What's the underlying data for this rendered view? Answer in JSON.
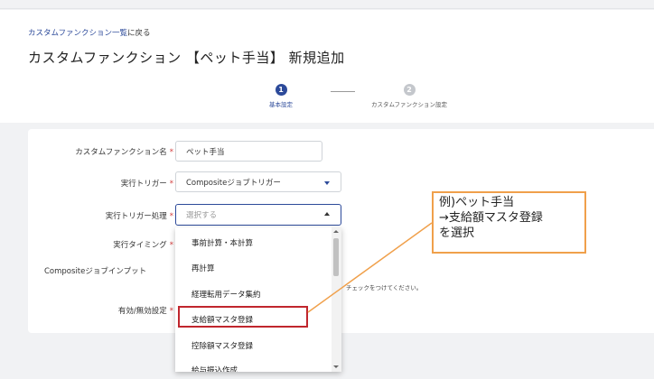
{
  "breadcrumb": {
    "link": "カスタムファンクション一覧",
    "suffix": "に戻る"
  },
  "page_title": "カスタムファンクション 【ペット手当】 新規追加",
  "steps": [
    {
      "number": "1",
      "label": "基本設定",
      "active": true
    },
    {
      "number": "2",
      "label": "カスタムファンクション設定",
      "active": false
    }
  ],
  "form": {
    "name_label": "カスタムファンクション名",
    "name_value": "ペット手当",
    "trigger_label": "実行トリガー",
    "trigger_value": "Compositeジョブトリガー",
    "trigger_process_label": "実行トリガー処理",
    "trigger_process_placeholder": "選択する",
    "timing_label": "実行タイミング",
    "job_input_label": "Compositeジョブインプット",
    "job_input_hint": "チェックをつけてください。",
    "enabled_label": "有効/無効設定",
    "required_mark": "*"
  },
  "dropdown": {
    "options": [
      "事前計算・本計算",
      "再計算",
      "経理転用データ集約",
      "支給額マスタ登録",
      "控除額マスタ登録",
      "給与振込作成"
    ],
    "highlighted": "支給額マスタ登録"
  },
  "callout": {
    "lines": [
      "例)ペット手当",
      "→支給額マスタ登録",
      "を選択"
    ]
  },
  "colors": {
    "accent": "#2c4a9a",
    "required": "#d23c3c",
    "highlight": "#c0262d",
    "callout_border": "#f0a04b"
  }
}
